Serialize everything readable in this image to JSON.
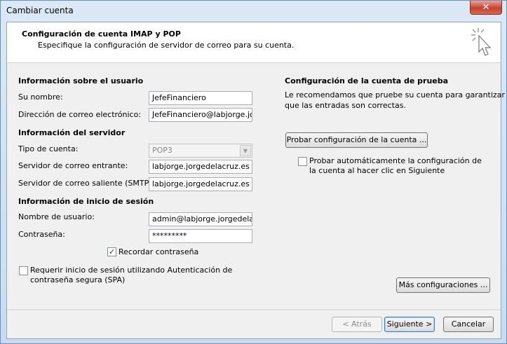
{
  "window": {
    "title": "Cambiar cuenta",
    "close_glyph": "✕"
  },
  "header": {
    "title": "Configuración de cuenta IMAP y POP",
    "subtitle": "Especifique la configuración de servidor de correo para su cuenta.",
    "icon": "cursor-click-icon"
  },
  "user_info": {
    "section": "Información sobre el usuario",
    "name_label": "Su nombre:",
    "name_value": "JefeFinanciero",
    "email_label": "Dirección de correo electrónico:",
    "email_value": "JefeFinanciero@labjorge.jorgedelacruz.es"
  },
  "server_info": {
    "section": "Información del servidor",
    "account_type_label": "Tipo de cuenta:",
    "account_type_value": "POP3",
    "incoming_label": "Servidor de correo entrante:",
    "incoming_value": "labjorge.jorgedelacruz.es",
    "outgoing_label": "Servidor de correo saliente (SMTP):",
    "outgoing_value": "labjorge.jorgedelacruz.es"
  },
  "login_info": {
    "section": "Información de inicio de sesión",
    "username_label": "Nombre de usuario:",
    "username_value": "admin@labjorge.jorgedelacruz.es",
    "password_label": "Contraseña:",
    "password_value": "*********",
    "remember_label": "Recordar contraseña",
    "remember_checked": true,
    "spa_label_line1": "Requerir inicio de sesión utilizando Autenticación de",
    "spa_label_line2": "contraseña segura (SPA)",
    "spa_checked": false
  },
  "test": {
    "section": "Configuración de la cuenta de prueba",
    "desc_line1": "Le recomendamos que pruebe su cuenta para garantizar",
    "desc_line2": "que las entradas son correctas.",
    "test_button": "Probar configuración de la cuenta ...",
    "auto_label_line1": "Probar automáticamente la configuración de",
    "auto_label_line2": "la cuenta al hacer clic en Siguiente",
    "auto_checked": false,
    "more_settings": "Más configuraciones ..."
  },
  "footer": {
    "back": "< Atrás",
    "next": "Siguiente >",
    "cancel": "Cancelar"
  },
  "check_glyph": "✓"
}
